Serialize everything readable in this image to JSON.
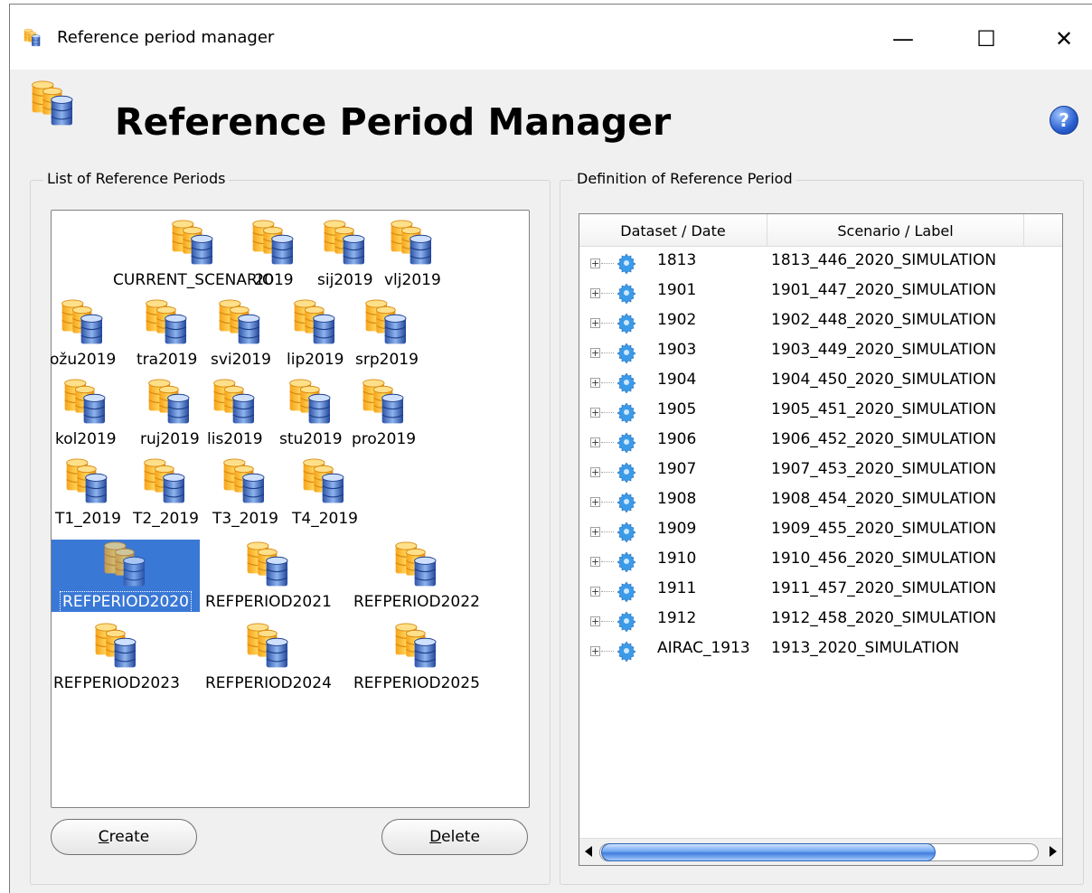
{
  "window": {
    "title": "Reference period manager",
    "minimize": "—",
    "maximize": "☐",
    "close": "✕"
  },
  "header": {
    "heading": "Reference Period Manager",
    "help": "?"
  },
  "left": {
    "label": "List of Reference Periods",
    "items": [
      {
        "label": "CURRENT_SCENARIO"
      },
      {
        "label": "2019"
      },
      {
        "label": "sij2019"
      },
      {
        "label": "vlj2019"
      },
      {
        "label": "ožu2019"
      },
      {
        "label": "tra2019"
      },
      {
        "label": "svi2019"
      },
      {
        "label": "lip2019"
      },
      {
        "label": "srp2019"
      },
      {
        "label": "kol2019"
      },
      {
        "label": "ruj2019"
      },
      {
        "label": "lis2019"
      },
      {
        "label": "stu2019"
      },
      {
        "label": "pro2019"
      },
      {
        "label": "T1_2019"
      },
      {
        "label": "T2_2019"
      },
      {
        "label": "T3_2019"
      },
      {
        "label": "T4_2019"
      },
      {
        "label": "REFPERIOD2020"
      },
      {
        "label": "REFPERIOD2021"
      },
      {
        "label": "REFPERIOD2022"
      },
      {
        "label": "REFPERIOD2023"
      },
      {
        "label": "REFPERIOD2024"
      },
      {
        "label": "REFPERIOD2025"
      }
    ],
    "selected": "REFPERIOD2020",
    "create_first": "C",
    "create_rest": "reate",
    "delete_first": "D",
    "delete_rest": "elete"
  },
  "right": {
    "label": "Definition of Reference Period",
    "columns": [
      "Dataset / Date",
      "Scenario / Label",
      ""
    ],
    "rows": [
      {
        "date": "1813",
        "label": "1813_446_2020_SIMULATION"
      },
      {
        "date": "1901",
        "label": "1901_447_2020_SIMULATION"
      },
      {
        "date": "1902",
        "label": "1902_448_2020_SIMULATION"
      },
      {
        "date": "1903",
        "label": "1903_449_2020_SIMULATION"
      },
      {
        "date": "1904",
        "label": "1904_450_2020_SIMULATION"
      },
      {
        "date": "1905",
        "label": "1905_451_2020_SIMULATION"
      },
      {
        "date": "1906",
        "label": "1906_452_2020_SIMULATION"
      },
      {
        "date": "1907",
        "label": "1907_453_2020_SIMULATION"
      },
      {
        "date": "1908",
        "label": "1908_454_2020_SIMULATION"
      },
      {
        "date": "1909",
        "label": "1909_455_2020_SIMULATION"
      },
      {
        "date": "1910",
        "label": "1910_456_2020_SIMULATION"
      },
      {
        "date": "1911",
        "label": "1911_457_2020_SIMULATION"
      },
      {
        "date": "1912",
        "label": "1912_458_2020_SIMULATION"
      },
      {
        "date": "AIRAC_1913",
        "label": "1913_2020_SIMULATION"
      }
    ]
  }
}
